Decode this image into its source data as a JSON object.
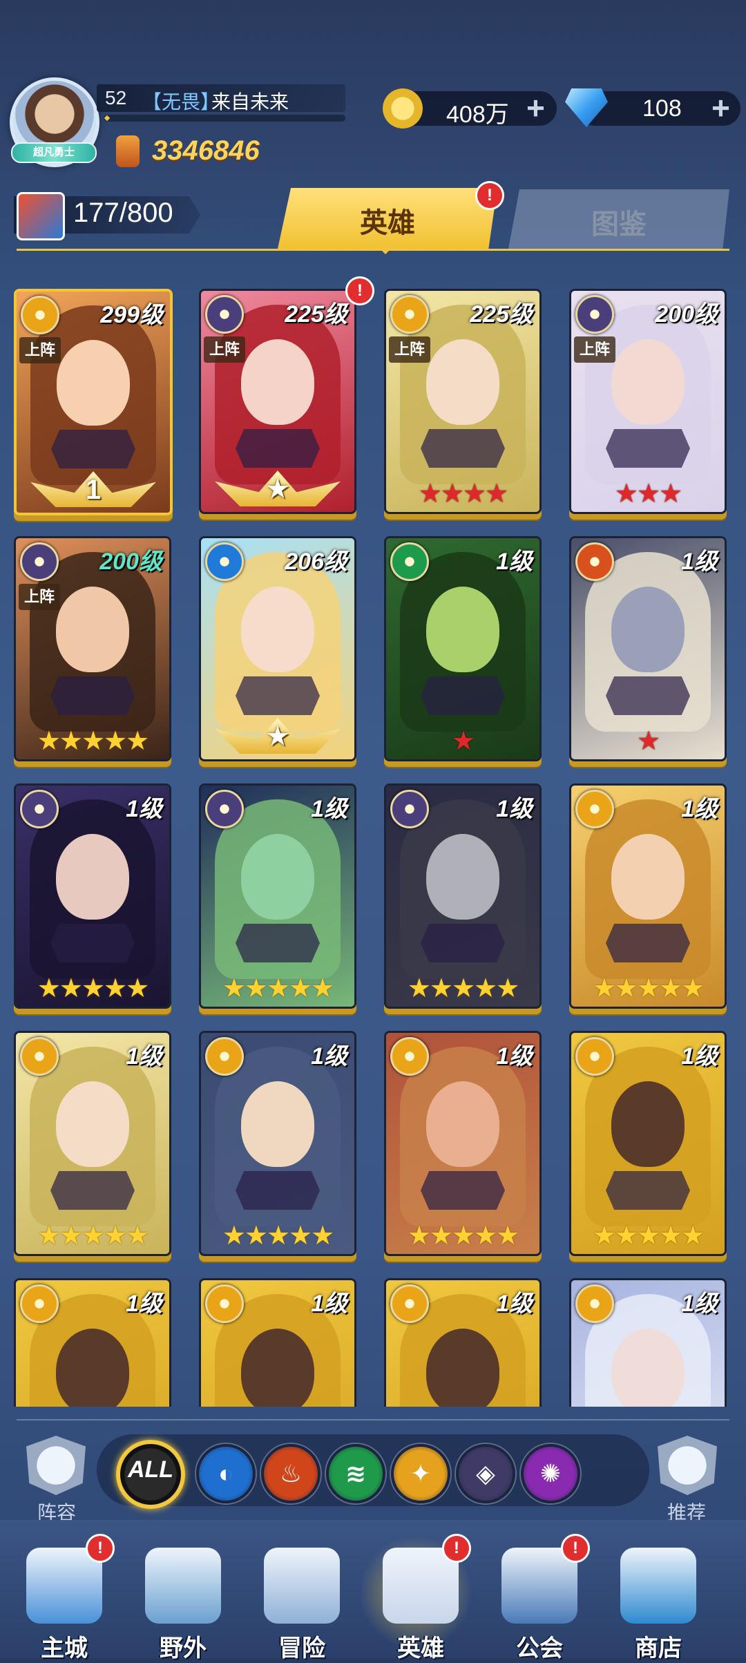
{
  "player": {
    "level": "52",
    "guild_tag": "【无畏】",
    "name": "来自未来",
    "rank_title": "超凡勇士",
    "power": "3346846"
  },
  "resources": {
    "gold": "408万",
    "diamonds": "108",
    "plus": "+"
  },
  "hero_count": "177/800",
  "tabs": {
    "heroes": "英雄",
    "codex": "图鉴",
    "heroes_badge": "!"
  },
  "tag_on_team": "上阵",
  "heroes": [
    {
      "level": "299级",
      "faction": "light",
      "on_team": true,
      "stars": "",
      "wings": "1",
      "rarity": "gold",
      "art": "warm",
      "badge": false
    },
    {
      "level": "225级",
      "faction": "dark",
      "on_team": true,
      "stars": "",
      "wings": "★",
      "rarity": "gold",
      "art": "red",
      "badge": true
    },
    {
      "level": "225级",
      "faction": "light",
      "on_team": true,
      "stars": "★★★★",
      "star_color": "red",
      "rarity": "gold",
      "art": "blonde",
      "badge": false
    },
    {
      "level": "200级",
      "faction": "dark",
      "on_team": true,
      "stars": "★★★",
      "star_color": "red",
      "rarity": "gold",
      "art": "white",
      "badge": false
    },
    {
      "level": "200级",
      "faction": "dark",
      "on_team": true,
      "stars": "★★★★★",
      "star_color": "gold",
      "rarity": "gold",
      "art": "brunette",
      "badge": false,
      "level_color": "teal"
    },
    {
      "level": "206级",
      "faction": "water",
      "on_team": false,
      "stars": "",
      "wings": "★",
      "rarity": "gold",
      "art": "bride",
      "badge": false
    },
    {
      "level": "1级",
      "faction": "wind",
      "on_team": false,
      "stars": "★",
      "star_color": "red",
      "rarity": "gold",
      "art": "green",
      "badge": false
    },
    {
      "level": "1级",
      "faction": "fire",
      "on_team": false,
      "stars": "★",
      "star_color": "red",
      "rarity": "gold",
      "art": "robot",
      "badge": false
    },
    {
      "level": "1级",
      "faction": "dark",
      "on_team": false,
      "stars": "★★★★★",
      "star_color": "gold",
      "rarity": "gold",
      "art": "purple",
      "badge": false
    },
    {
      "level": "1级",
      "faction": "dark",
      "on_team": false,
      "stars": "★★★★★",
      "star_color": "gold",
      "rarity": "gold",
      "art": "bird",
      "badge": false
    },
    {
      "level": "1级",
      "faction": "dark",
      "on_team": false,
      "stars": "★★★★★",
      "star_color": "gold",
      "rarity": "gold",
      "art": "knight",
      "badge": false
    },
    {
      "level": "1级",
      "faction": "light",
      "on_team": false,
      "stars": "★★★★★",
      "star_color": "gold",
      "rarity": "gold",
      "art": "goggles",
      "badge": false
    },
    {
      "level": "1级",
      "faction": "light",
      "on_team": false,
      "stars": "★★★★★",
      "star_color": "gold",
      "rarity": "gold",
      "art": "blonde",
      "badge": false
    },
    {
      "level": "1级",
      "faction": "light",
      "on_team": false,
      "stars": "★★★★★",
      "star_color": "gold",
      "rarity": "gold",
      "art": "storm",
      "badge": false
    },
    {
      "level": "1级",
      "faction": "light",
      "on_team": false,
      "stars": "★★★★★",
      "star_color": "gold",
      "rarity": "gold",
      "art": "monkey",
      "badge": false
    },
    {
      "level": "1级",
      "faction": "light",
      "on_team": false,
      "stars": "★★★★★",
      "star_color": "gold",
      "rarity": "gold",
      "art": "goddess",
      "badge": false
    },
    {
      "level": "1级",
      "faction": "light",
      "on_team": false,
      "stars": "",
      "rarity": "gold",
      "art": "goddess",
      "badge": false
    },
    {
      "level": "1级",
      "faction": "light",
      "on_team": false,
      "stars": "",
      "rarity": "gold",
      "art": "goddess",
      "badge": false
    },
    {
      "level": "1级",
      "faction": "light",
      "on_team": false,
      "stars": "",
      "rarity": "gold",
      "art": "goddess",
      "badge": false
    },
    {
      "level": "1级",
      "faction": "light",
      "on_team": false,
      "stars": "",
      "rarity": "gold",
      "art": "silver",
      "badge": false
    }
  ],
  "filters": {
    "all": "ALL",
    "factions": [
      {
        "name": "water-faction-icon",
        "color": "#1f6fd0",
        "glyph": "◐"
      },
      {
        "name": "fire-faction-icon",
        "color": "#d0461a",
        "glyph": "♨"
      },
      {
        "name": "wind-faction-icon",
        "color": "#1f9a4a",
        "glyph": "≋"
      },
      {
        "name": "light-faction-icon",
        "color": "#e6a11d",
        "glyph": "✦"
      },
      {
        "name": "dark-faction-icon",
        "color": "#3f3a66",
        "glyph": "◈"
      },
      {
        "name": "arcane-faction-icon",
        "color": "#8a2ab0",
        "glyph": "✺"
      }
    ]
  },
  "side_buttons": {
    "lineup": "阵容",
    "recommend": "推荐"
  },
  "nav": [
    {
      "label": "主城",
      "badge": true,
      "icon": "castle-icon"
    },
    {
      "label": "野外",
      "badge": false,
      "icon": "portal-icon"
    },
    {
      "label": "冒险",
      "badge": false,
      "icon": "sword-icon"
    },
    {
      "label": "英雄",
      "badge": true,
      "icon": "helmet-icon",
      "active": true
    },
    {
      "label": "公会",
      "badge": true,
      "icon": "banner-icon"
    },
    {
      "label": "商店",
      "badge": false,
      "icon": "shop-icon"
    }
  ],
  "colors": {
    "accent_gold": "#f1c132",
    "badge_red": "#e12d2d",
    "power_text": "#ffd45a"
  }
}
